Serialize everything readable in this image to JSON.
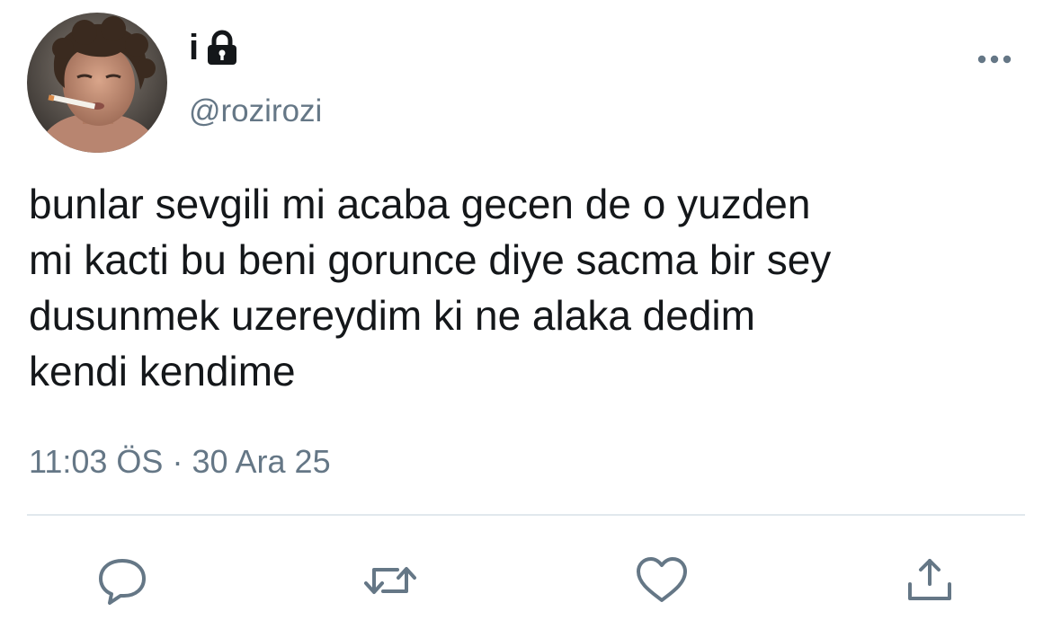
{
  "tweet": {
    "display_name": "i",
    "handle": "@rozirozi",
    "text": "bunlar sevgili mi acaba gecen de o yuzden\nmi kacti bu beni gorunce diye sacma bir sey\ndusunmek uzereydim ki ne alaka dedim\nkendi kendime",
    "time": "11:03 ÖS",
    "separator": "·",
    "date": "30 Ara 25"
  },
  "icons": {
    "lock": "lock-icon",
    "more": "more-options-icon",
    "reply": "reply-icon",
    "retweet": "retweet-icon",
    "like": "heart-icon",
    "share": "share-icon"
  },
  "colors": {
    "text": "#14171a",
    "secondary": "#657786",
    "action": "#1da1f2",
    "divider": "#e1e8ed"
  }
}
